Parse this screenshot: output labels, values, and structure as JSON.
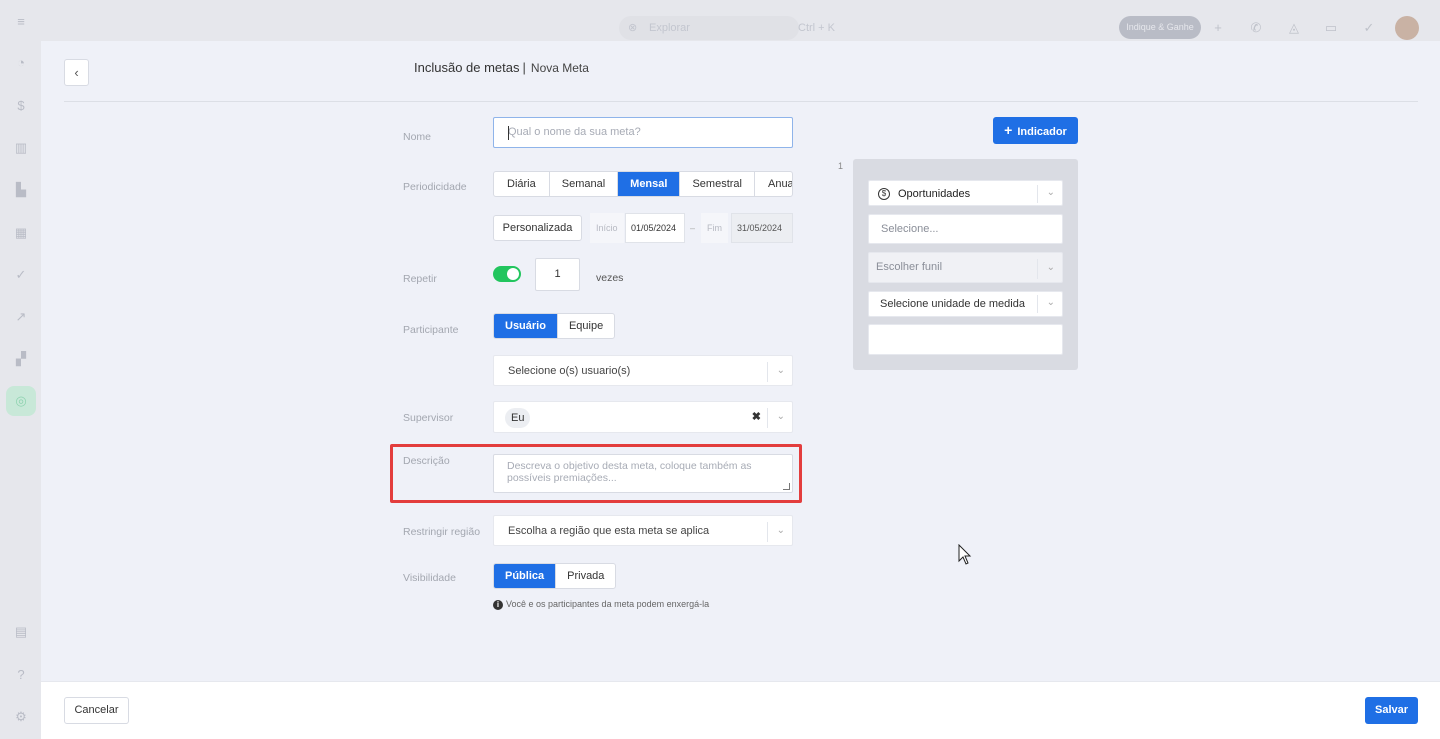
{
  "background": {
    "search": {
      "placeholder": "Explorar",
      "shortcut": "Ctrl + K"
    },
    "indique_label": "Indique & Ganhe"
  },
  "modal": {
    "title": "Inclusão de metas",
    "separator": "|",
    "subtitle": "Nova Meta",
    "labels": {
      "nome": "Nome",
      "periodicidade": "Periodicidade",
      "repetir": "Repetir",
      "participante": "Participante",
      "supervisor": "Supervisor",
      "descricao": "Descrição",
      "restringir": "Restringir região",
      "visibilidade": "Visibilidade"
    },
    "nome_placeholder": "Qual o nome da sua meta?",
    "periodicidade": {
      "options": [
        "Diária",
        "Semanal",
        "Mensal",
        "Semestral",
        "Anual"
      ],
      "selected": "Mensal",
      "custom_label": "Personalizada",
      "inicio_label": "Início",
      "inicio_value": "01/05/2024",
      "range_sep": "–",
      "fim_label": "Fim",
      "fim_value": "31/05/2024"
    },
    "repetir": {
      "enabled": true,
      "count": "1",
      "suffix": "vezes"
    },
    "participante": {
      "options": [
        "Usuário",
        "Equipe"
      ],
      "selected": "Usuário",
      "users_placeholder": "Selecione o(s) usuario(s)"
    },
    "supervisor": {
      "chip": "Eu",
      "clear": "✖"
    },
    "descricao_placeholder": "Descreva o objetivo desta meta, coloque também as possíveis premiações...",
    "regiao_placeholder": "Escolha a região que esta meta se aplica",
    "visibilidade": {
      "options": [
        "Pública",
        "Privada"
      ],
      "selected": "Pública",
      "info": "Você e os participantes da meta podem enxergá-la"
    },
    "indicador_button": "Indicador",
    "indicador_card": {
      "index": "1",
      "type": "Oportunidades",
      "selecione_placeholder": "Selecione...",
      "funil_placeholder": "Escolher funil",
      "unidade_placeholder": "Selecione unidade de medida",
      "value": ""
    },
    "footer": {
      "cancel": "Cancelar",
      "save": "Salvar"
    }
  },
  "colors": {
    "primary": "#1f6fe5",
    "toggle_on": "#22c55e",
    "highlight": "#e33d3d"
  }
}
